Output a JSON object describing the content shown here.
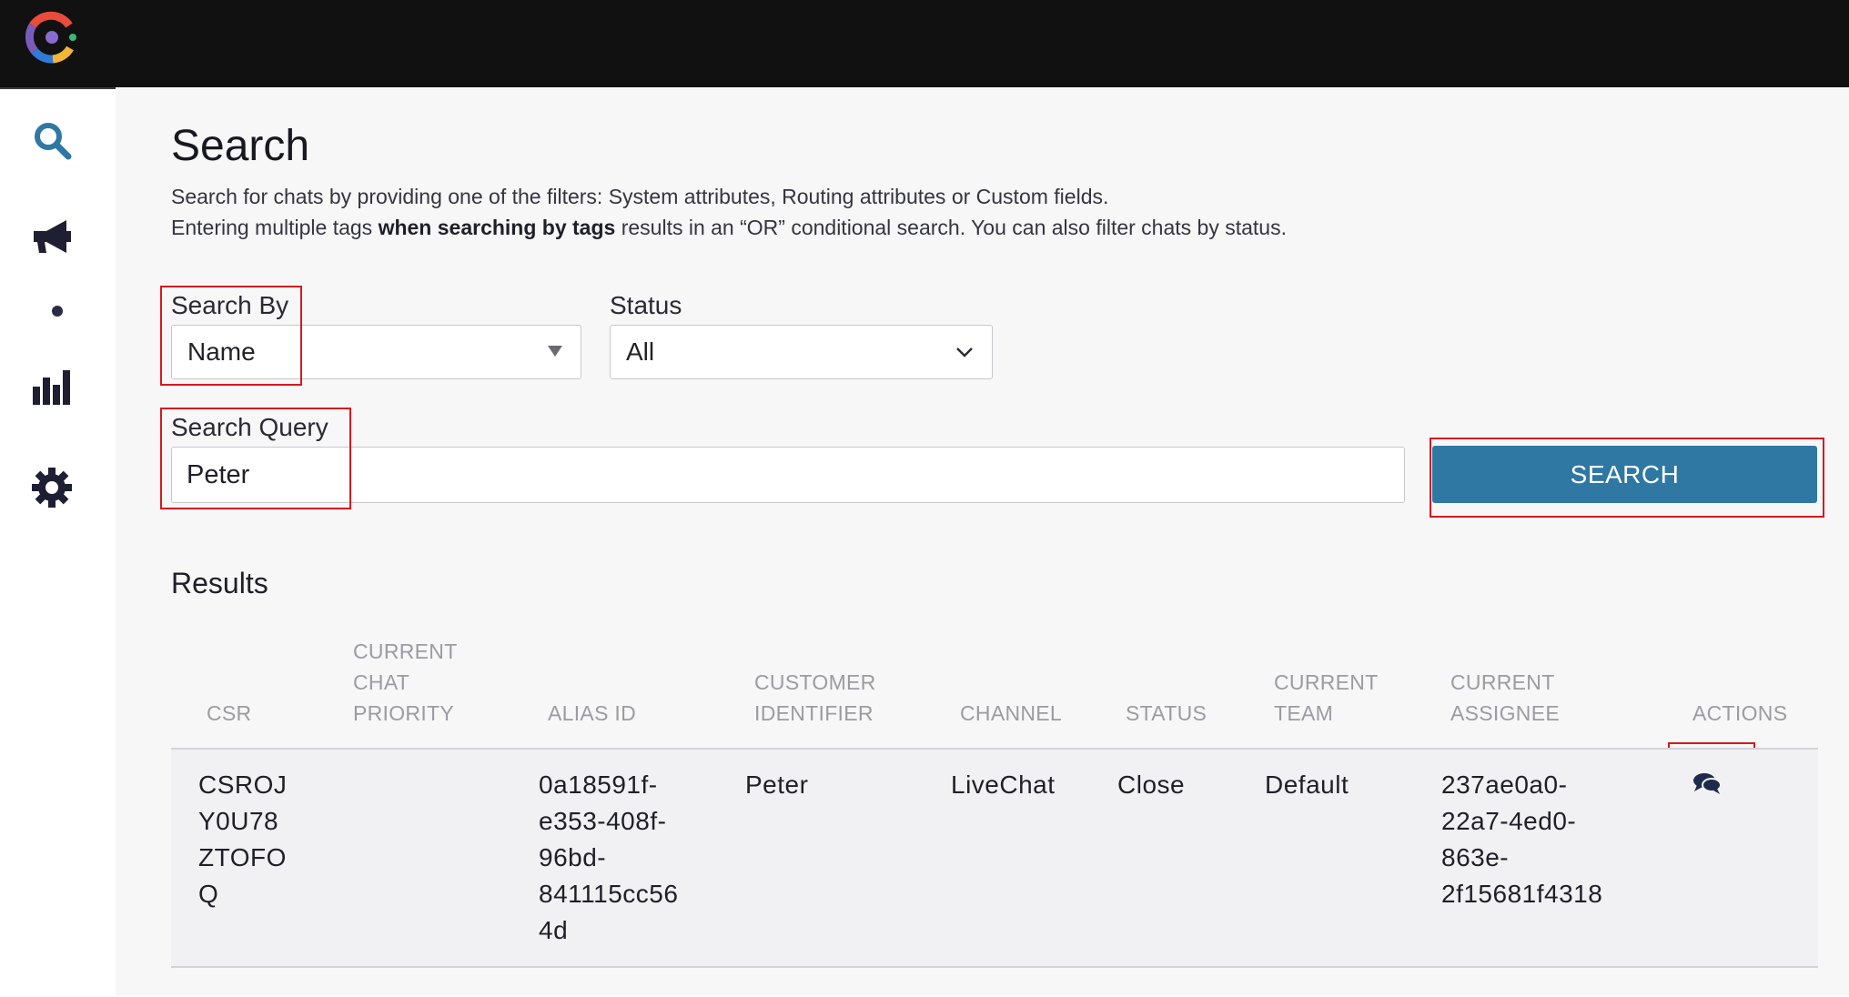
{
  "header": {
    "logo_icon": "multicolor-c-logo"
  },
  "sidebar": {
    "items": [
      {
        "icon": "search-icon"
      },
      {
        "icon": "megaphone-icon"
      },
      {
        "icon": "dot-icon"
      },
      {
        "icon": "bar-chart-icon"
      },
      {
        "icon": "gear-icon"
      }
    ],
    "active_color": "#2f78a3",
    "icon_color": "#1f1f33"
  },
  "page": {
    "title": "Search",
    "description_line1": "Search for chats by providing one of the filters: System attributes, Routing attributes or Custom fields.",
    "description_line2_pre": "Entering multiple tags ",
    "description_line2_bold": "when searching by tags",
    "description_line2_post": " results in an “OR” conditional search. You can also filter chats by status."
  },
  "filters": {
    "search_by": {
      "label": "Search By",
      "value": "Name"
    },
    "status": {
      "label": "Status",
      "value": "All"
    },
    "search_query": {
      "label": "Search Query",
      "value": "Peter"
    },
    "search_button": "SEARCH"
  },
  "results": {
    "title": "Results",
    "columns": {
      "csr": "CSR",
      "priority_1": "CURRENT",
      "priority_2": "CHAT",
      "priority_3": "PRIORITY",
      "alias": "ALIAS ID",
      "customer_1": "CUSTOMER",
      "customer_2": "IDENTIFIER",
      "channel": "CHANNEL",
      "status": "STATUS",
      "team_1": "CURRENT",
      "team_2": "TEAM",
      "assignee_1": "CURRENT",
      "assignee_2": "ASSIGNEE",
      "actions": "ACTIONS"
    },
    "rows": [
      {
        "csr_lines": [
          "CSROJ",
          "Y0U78",
          "ZTOFO",
          "Q"
        ],
        "priority": "",
        "alias_lines": [
          "0a18591f-",
          "e353-408f-",
          "96bd-",
          "841115cc56",
          "4d"
        ],
        "customer": "Peter",
        "channel": "LiveChat",
        "status": "Close",
        "team": "Default",
        "assignee_lines": [
          "237ae0a0-",
          "22a7-4ed0-",
          "863e-",
          "2f15681f4318"
        ],
        "action_icon": "chat-bubbles-icon"
      }
    ]
  },
  "highlight_color": "#d6191f",
  "button_color": "#2f78a3"
}
